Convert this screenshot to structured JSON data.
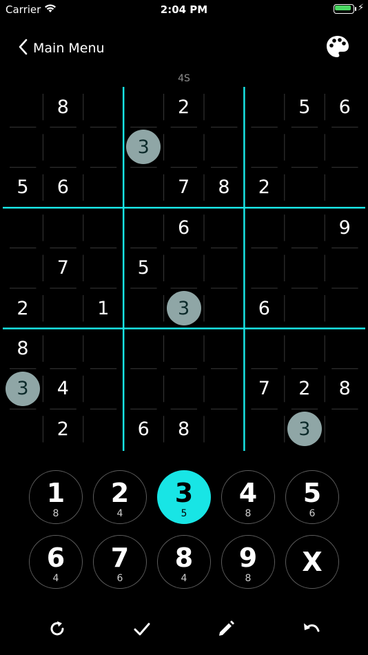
{
  "status_bar": {
    "carrier": "Carrier",
    "time": "2:04 PM"
  },
  "nav": {
    "back_label": "Main Menu",
    "back_icon": "chevron-left-icon",
    "palette_icon": "palette-icon"
  },
  "puzzle": {
    "id": "4S",
    "selected_number": "3",
    "grid": [
      [
        "",
        "8",
        "",
        "",
        "2",
        "",
        "",
        "5",
        "6"
      ],
      [
        "",
        "",
        "",
        "3",
        "",
        "",
        "",
        "",
        ""
      ],
      [
        "5",
        "6",
        "",
        "",
        "7",
        "8",
        "2",
        "",
        ""
      ],
      [
        "",
        "",
        "",
        "",
        "6",
        "",
        "",
        "",
        "9"
      ],
      [
        "",
        "7",
        "",
        "5",
        "",
        "",
        "",
        "",
        ""
      ],
      [
        "2",
        "",
        "1",
        "",
        "3",
        "",
        "6",
        "",
        ""
      ],
      [
        "8",
        "",
        "",
        "",
        "",
        "",
        "",
        "",
        ""
      ],
      [
        "3",
        "4",
        "",
        "",
        "",
        "",
        "7",
        "2",
        "8"
      ],
      [
        "",
        "2",
        "",
        "6",
        "8",
        "",
        "",
        "3",
        ""
      ]
    ]
  },
  "number_pad": [
    {
      "digit": "1",
      "remaining": "8"
    },
    {
      "digit": "2",
      "remaining": "4"
    },
    {
      "digit": "3",
      "remaining": "5"
    },
    {
      "digit": "4",
      "remaining": "8"
    },
    {
      "digit": "5",
      "remaining": "6"
    },
    {
      "digit": "6",
      "remaining": "4"
    },
    {
      "digit": "7",
      "remaining": "6"
    },
    {
      "digit": "8",
      "remaining": "4"
    },
    {
      "digit": "9",
      "remaining": "8"
    },
    {
      "digit": "X",
      "remaining": ""
    }
  ],
  "toolbar": {
    "icons": [
      "restart-icon",
      "check-icon",
      "pencil-icon",
      "undo-icon"
    ]
  },
  "colors": {
    "accent": "#18e5e5",
    "highlight": "#8fa6a6",
    "battery": "#4cd964"
  }
}
